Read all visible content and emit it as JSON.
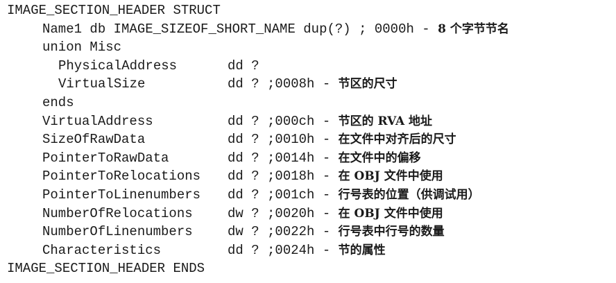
{
  "header": {
    "struct_open": "IMAGE_SECTION_HEADER STRUCT",
    "struct_close": "IMAGE_SECTION_HEADER ENDS"
  },
  "name1": {
    "code": "Name1 db IMAGE_SIZEOF_SHORT_NAME dup(?) ; 0000h - ",
    "comment": "8 个字节节名"
  },
  "union": {
    "open": "union Misc",
    "close": "ends"
  },
  "union_fields": [
    {
      "name": "PhysicalAddress",
      "decl": "dd ?",
      "offset": "",
      "comment": ""
    },
    {
      "name": "VirtualSize",
      "decl": "dd ? ;0008h - ",
      "comment": "节区的尺寸"
    }
  ],
  "fields": [
    {
      "name": "VirtualAddress",
      "decl": "dd ? ;000ch - ",
      "comment": "节区的 RVA 地址"
    },
    {
      "name": "SizeOfRawData",
      "decl": "dd ? ;0010h - ",
      "comment": "在文件中对齐后的尺寸"
    },
    {
      "name": "PointerToRawData",
      "decl": "dd ? ;0014h - ",
      "comment": "在文件中的偏移"
    },
    {
      "name": "PointerToRelocations",
      "decl": "dd ? ;0018h - ",
      "comment": "在 OBJ 文件中使用"
    },
    {
      "name": "PointerToLinenumbers",
      "decl": "dd ? ;001ch - ",
      "comment": "行号表的位置（供调试用）"
    },
    {
      "name": "NumberOfRelocations",
      "decl": "dw ? ;0020h - ",
      "comment": "在 OBJ 文件中使用"
    },
    {
      "name": "NumberOfLinenumbers",
      "decl": "dw ? ;0022h - ",
      "comment": "行号表中行号的数量"
    },
    {
      "name": "Characteristics",
      "decl": "dd ? ;0024h - ",
      "comment": "节的属性"
    }
  ]
}
